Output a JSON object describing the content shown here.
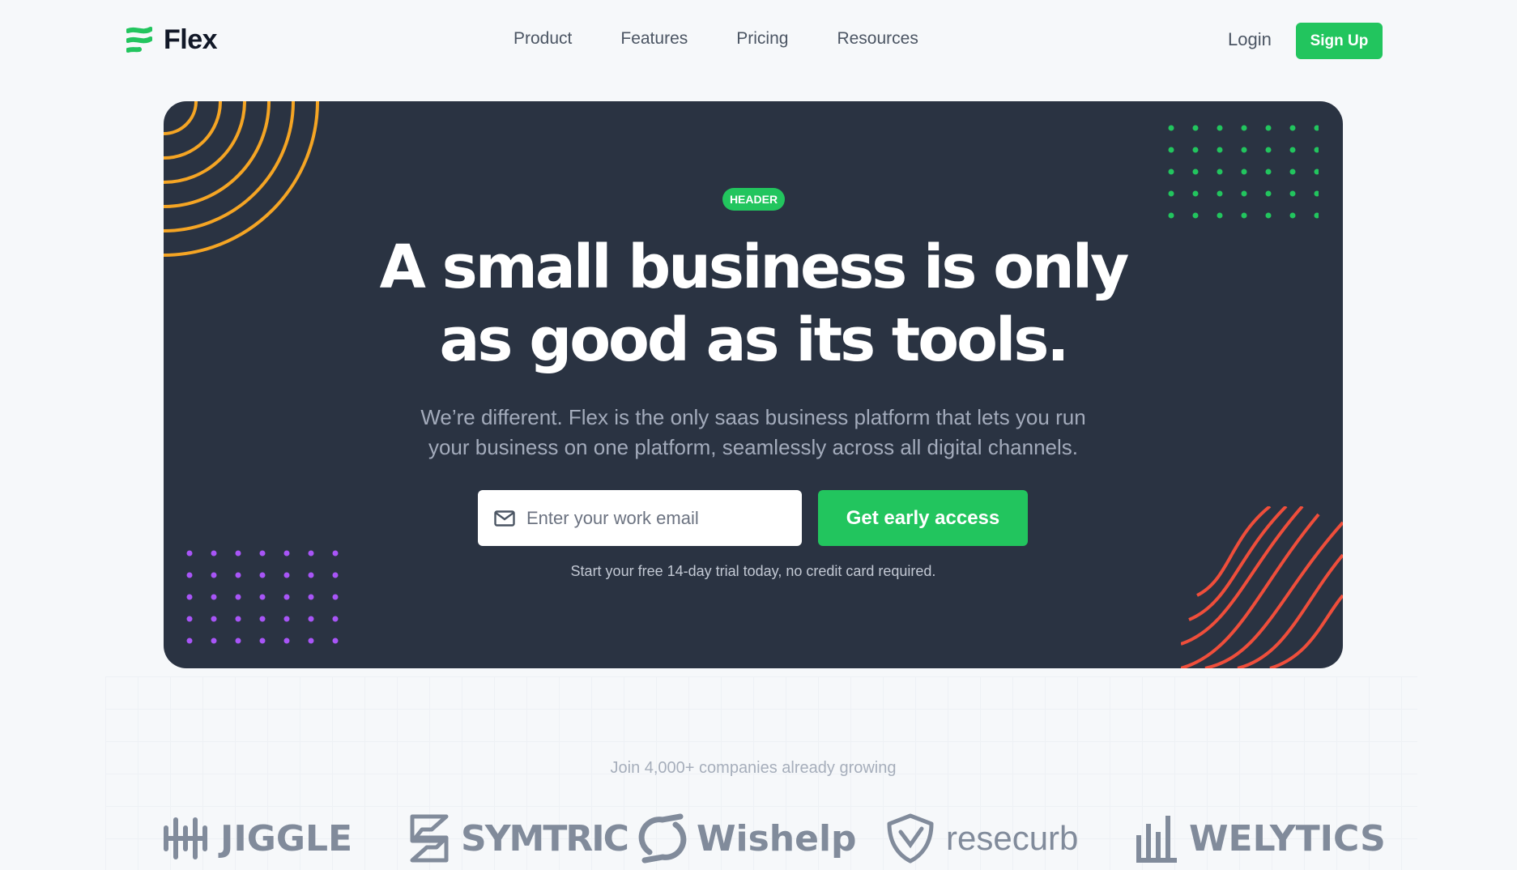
{
  "nav": {
    "brand": "Flex",
    "links": [
      "Product",
      "Features",
      "Pricing",
      "Resources"
    ],
    "login": "Login",
    "signup": "Sign Up"
  },
  "hero": {
    "badge": "HEADER",
    "headline_line1": "A small business is only",
    "headline_line2": "as good as its tools.",
    "subtext_line1": "We’re different. Flex is the only saas business platform that lets you run",
    "subtext_line2": "your business on one platform, seamlessly across all digital channels.",
    "email_placeholder": "Enter your work email",
    "cta": "Get early access",
    "trial_note": "Start your free 14-day trial today, no credit card required."
  },
  "social_proof": {
    "heading": "Join 4,000+ companies already growing",
    "companies": [
      "JIGGLE",
      "SYMTRIC",
      "Wishelp",
      "resecurb",
      "WELYTICS"
    ]
  },
  "colors": {
    "accent": "#22c55e",
    "hero_bg": "#2a3342",
    "orange": "#f5a524",
    "red": "#ef4e3b",
    "purple": "#a855f7"
  }
}
